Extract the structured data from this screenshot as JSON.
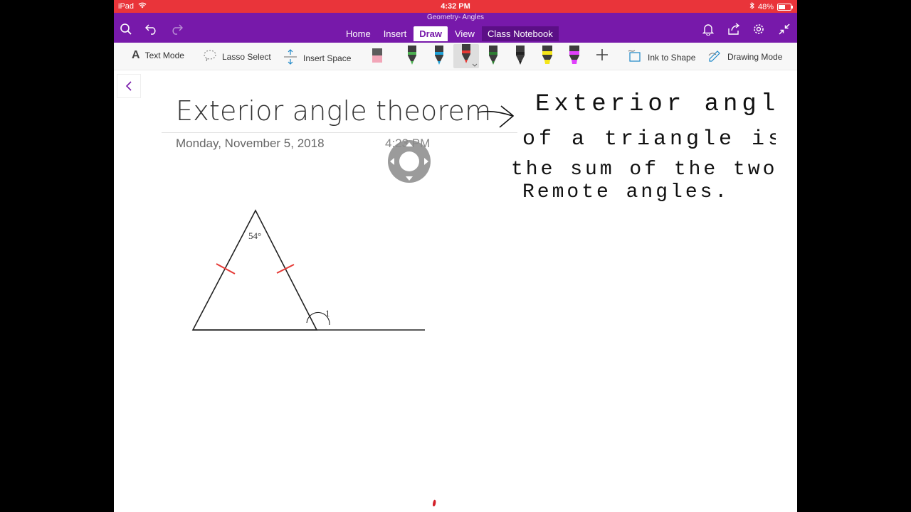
{
  "status_bar": {
    "device": "iPad",
    "time": "4:32 PM",
    "battery": "48%"
  },
  "ribbon": {
    "notebook_title": "Geometry- Angles",
    "tabs": [
      {
        "label": "Home",
        "active": false
      },
      {
        "label": "Insert",
        "active": false
      },
      {
        "label": "Draw",
        "active": true
      },
      {
        "label": "View",
        "active": false
      },
      {
        "label": "Class Notebook",
        "active": false
      }
    ],
    "accent_color": "#7719aa"
  },
  "toolbar": {
    "text_mode": "Text Mode",
    "lasso_select": "Lasso Select",
    "insert_space": "Insert Space",
    "ink_to_shape": "Ink to Shape",
    "drawing_mode": "Drawing Mode",
    "pens": [
      {
        "name": "eraser",
        "color": "#f2a6b8"
      },
      {
        "name": "green-pen",
        "color": "#4caf50"
      },
      {
        "name": "blue-pen",
        "color": "#1ea0d6"
      },
      {
        "name": "red-pen",
        "color": "#e53935",
        "selected": true
      },
      {
        "name": "dark-green-pen",
        "color": "#2e7d32"
      },
      {
        "name": "black-pen",
        "color": "#333333"
      },
      {
        "name": "yellow-highlighter",
        "color": "#f5e61a"
      },
      {
        "name": "magenta-highlighter",
        "color": "#e040fb"
      }
    ]
  },
  "page": {
    "title": "Exterior angle theorem",
    "date": "Monday, November 5, 2018",
    "time": "4:23 PM",
    "handwritten_note": [
      "Exterior angle",
      "of a triangle is",
      "the sum of the two",
      "Remote angles."
    ],
    "diagram": {
      "apex_angle_label": "54°",
      "exterior_angle_label": "1"
    }
  }
}
